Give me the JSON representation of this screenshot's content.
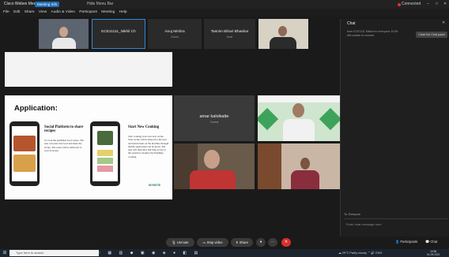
{
  "window": {
    "app_title": "Cisco Webex Meetings",
    "meeting_chip": "Meeting Info",
    "host": "Hide Menu Bar",
    "connection": "Connected"
  },
  "menu": [
    "File",
    "Edit",
    "Share",
    "View",
    "Audio & Video",
    "Participant",
    "Meeting",
    "Help"
  ],
  "participants": [
    {
      "name": "",
      "sub": ""
    },
    {
      "name": "ECE11111_Nikhil Ch",
      "sub": ""
    },
    {
      "name": "Anuj Mishra",
      "sub": "Guest"
    },
    {
      "name": "Tasnim Bihari Bhaskar",
      "sub": "Host"
    },
    {
      "name": "",
      "sub": ""
    }
  ],
  "chat": {
    "title": "Chat",
    "notice": "from ECE1111 Mishra to everyone 10:56 AM unable to unmute",
    "close_panel": "Close the Chat panel",
    "to_label": "To: Everyone",
    "placeholder": "Enter chat message here"
  },
  "slide": {
    "title": "Application:",
    "col1_title": "Social Platform to share recipes",
    "col1_text": "To cook the published food recipe. The user can select the food and share the recipe. The order will be delivered to your doorstep.",
    "col2_title": "Start New Cooking",
    "col2_text": "Start cooking your own new recipe. Your recipe will be shared for the user and instructions on the machine through mobile application can be given. The user will then have full time access to the system to monitor the finishing cooking.",
    "logo": "MYBITE"
  },
  "videos": {
    "amar_name": "amar kalvikatte",
    "amar_sub": "Guest"
  },
  "controls": {
    "unmute": "Unmute",
    "stop_video": "Stop video",
    "share": "Share",
    "more": "···",
    "leave": "✕",
    "participants": "Participants",
    "chat": "Chat"
  },
  "taskbar": {
    "search": "Type here to search",
    "weather": "29°C Partly cloudy",
    "lang": "ENG",
    "time": "10:56",
    "date": "01-09-2021"
  },
  "colors": {
    "accent": "#2f8ad8",
    "leave": "#d9302c",
    "slide_green": "#2a7f4f"
  }
}
